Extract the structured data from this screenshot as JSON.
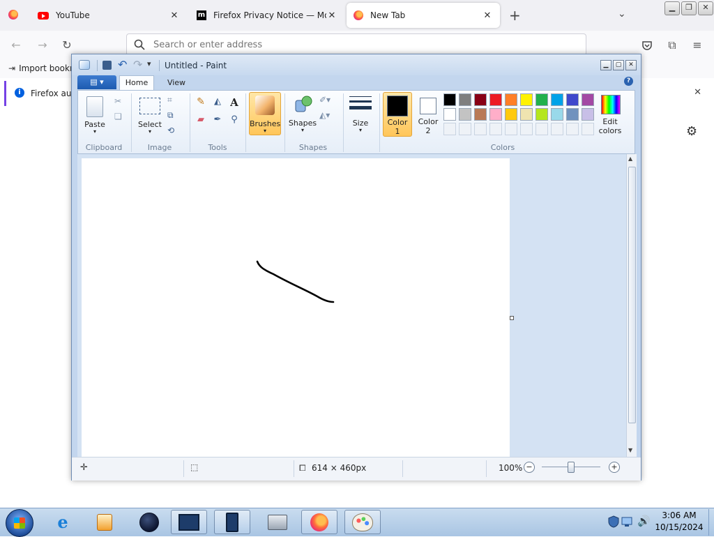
{
  "browser": {
    "tabs": [
      {
        "label": "YouTube",
        "icon": "youtube-icon",
        "active": false
      },
      {
        "label": "Firefox Privacy Notice — Mozill",
        "icon": "mozilla-icon",
        "active": false
      },
      {
        "label": "New Tab",
        "icon": "firefox-icon",
        "active": true
      }
    ],
    "new_tab_symbol": "+",
    "address_placeholder": "Search or enter address",
    "bookmark_import_label": "Import bookm",
    "notification_text": "Firefox auto"
  },
  "paint": {
    "title": "Untitled - Paint",
    "tabs": [
      "Home",
      "View"
    ],
    "active_tab": "Home",
    "groups": {
      "clipboard": {
        "label": "Clipboard",
        "paste": "Paste"
      },
      "image": {
        "label": "Image",
        "select": "Select"
      },
      "tools": {
        "label": "Tools"
      },
      "brushes": {
        "label": "Brushes"
      },
      "shapes": {
        "label": "Shapes",
        "shapes_btn": "Shapes"
      },
      "size": {
        "label": "Size"
      },
      "colors": {
        "label": "Colors",
        "color1_a": "Color",
        "color1_b": "1",
        "color2_a": "Color",
        "color2_b": "2",
        "edit_a": "Edit",
        "edit_b": "colors"
      }
    },
    "color1": "#000000",
    "color2": "#ffffff",
    "palette_row1": [
      "#000000",
      "#7f7f7f",
      "#880015",
      "#ed1c24",
      "#ff7f27",
      "#fff200",
      "#22b14c",
      "#00a2e8",
      "#3f48cc",
      "#a349a4"
    ],
    "palette_row2": [
      "#ffffff",
      "#c3c3c3",
      "#b97a57",
      "#ffaec9",
      "#ffc90e",
      "#efe4b0",
      "#b5e61d",
      "#99d9ea",
      "#7092be",
      "#c8bfe7"
    ],
    "status": {
      "dimensions": "614 × 460px",
      "zoom": "100%"
    }
  },
  "taskbar": {
    "time": "3:06 AM",
    "date": "10/15/2024"
  }
}
